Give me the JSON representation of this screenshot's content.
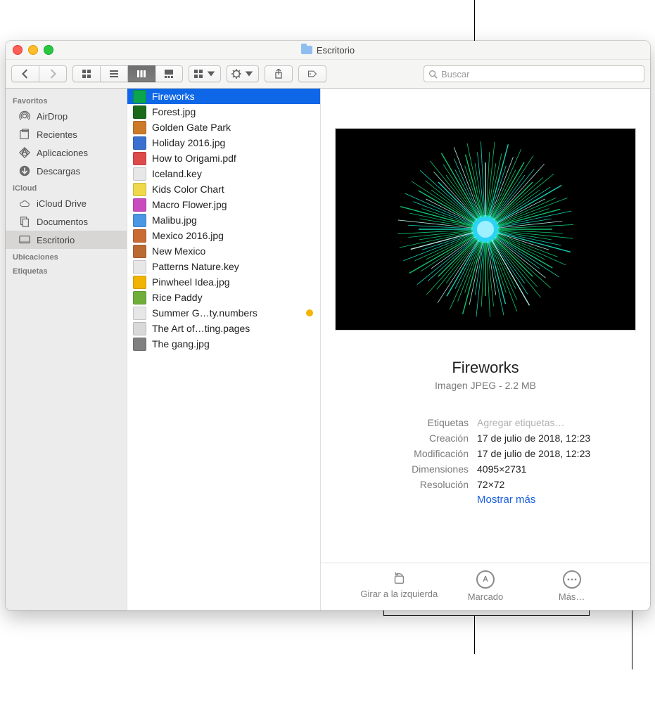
{
  "window": {
    "title": "Escritorio"
  },
  "search": {
    "placeholder": "Buscar"
  },
  "sidebar": {
    "sections": [
      {
        "header": "Favoritos",
        "items": [
          {
            "label": "AirDrop",
            "icon": "airdrop"
          },
          {
            "label": "Recientes",
            "icon": "recent"
          },
          {
            "label": "Aplicaciones",
            "icon": "apps"
          },
          {
            "label": "Descargas",
            "icon": "downloads"
          }
        ]
      },
      {
        "header": "iCloud",
        "items": [
          {
            "label": "iCloud Drive",
            "icon": "cloud"
          },
          {
            "label": "Documentos",
            "icon": "docs"
          },
          {
            "label": "Escritorio",
            "icon": "desktop",
            "selected": true
          }
        ]
      },
      {
        "header": "Ubicaciones",
        "items": []
      },
      {
        "header": "Etiquetas",
        "items": []
      }
    ]
  },
  "files": [
    {
      "name": "Fireworks",
      "swatch": "#0aa54d",
      "selected": true
    },
    {
      "name": "Forest.jpg",
      "swatch": "#1a6a1a"
    },
    {
      "name": "Golden Gate Park",
      "swatch": "#cc7a2a"
    },
    {
      "name": "Holiday 2016.jpg",
      "swatch": "#3a70cf"
    },
    {
      "name": "How to Origami.pdf",
      "swatch": "#dd4a4a"
    },
    {
      "name": "Iceland.key",
      "swatch": "#e7e7e7"
    },
    {
      "name": "Kids Color Chart",
      "swatch": "#efd84a"
    },
    {
      "name": "Macro Flower.jpg",
      "swatch": "#c94cbf"
    },
    {
      "name": "Malibu.jpg",
      "swatch": "#4a97e5"
    },
    {
      "name": "Mexico 2016.jpg",
      "swatch": "#c96b33"
    },
    {
      "name": "New Mexico",
      "swatch": "#b96b33"
    },
    {
      "name": "Patterns Nature.key",
      "swatch": "#e7e7e7"
    },
    {
      "name": "Pinwheel Idea.jpg",
      "swatch": "#f0b400"
    },
    {
      "name": "Rice Paddy",
      "swatch": "#6fae3b"
    },
    {
      "name": "Summer G…ty.numbers",
      "swatch": "#e7e7e7",
      "tag": "#f4b400"
    },
    {
      "name": "The Art of…ting.pages",
      "swatch": "#d9d9d9"
    },
    {
      "name": "The gang.jpg",
      "swatch": "#808080"
    }
  ],
  "preview": {
    "name": "Fireworks",
    "subtitle": "Imagen JPEG - 2.2 MB",
    "meta_labels": {
      "tags": "Etiquetas",
      "created": "Creación",
      "modified": "Modificación",
      "dimensions": "Dimensiones",
      "resolution": "Resolución"
    },
    "meta_values": {
      "tags_placeholder": "Agregar etiquetas…",
      "created": "17 de julio de 2018, 12:23",
      "modified": "17 de julio de 2018, 12:23",
      "dimensions": "4095×2731",
      "resolution": "72×72"
    },
    "show_more": "Mostrar más",
    "actions": {
      "rotate": "Girar a la izquierda",
      "markup": "Marcado",
      "more": "Más…"
    }
  }
}
